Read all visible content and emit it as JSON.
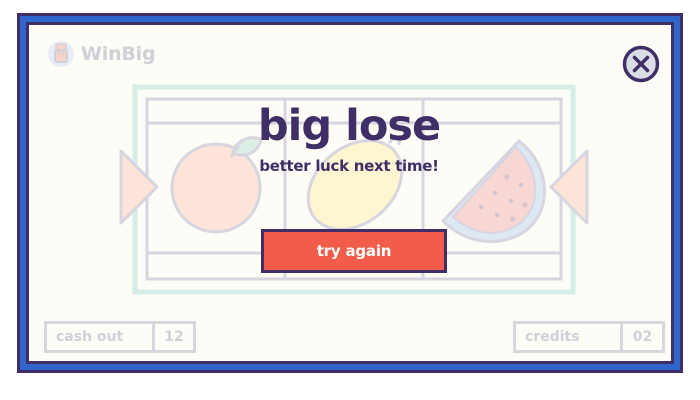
{
  "app": {
    "logo_text": "WinBig"
  },
  "result": {
    "title": "big lose",
    "subtitle": "better luck next time!",
    "retry_label": "try again"
  },
  "reels": {
    "symbols": [
      "orange-icon",
      "lemon-icon",
      "watermelon-icon"
    ]
  },
  "stats": {
    "cash_out_label": "cash out",
    "cash_out_value": "12",
    "credits_label": "credits",
    "credits_value": "02"
  },
  "colors": {
    "frame_dark": "#3f2f66",
    "frame_blue": "#2f66cc",
    "background": "#fdfcf6",
    "accent_red": "#f25c4a",
    "muted": "#d6d6dc"
  }
}
